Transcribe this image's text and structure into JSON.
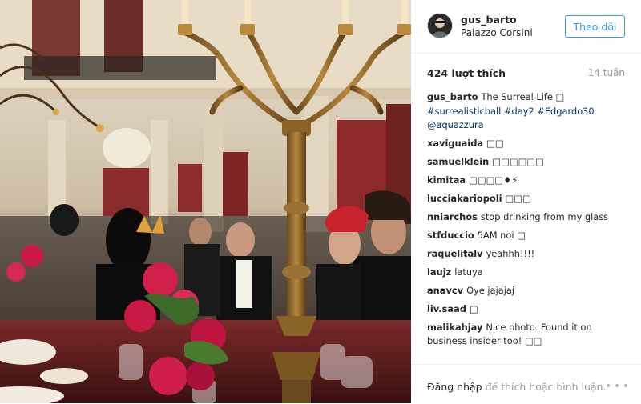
{
  "post": {
    "username": "gus_barto",
    "location": "Palazzo Corsini",
    "follow_label": "Theo dõi",
    "likes": "424 lượt thích",
    "time_ago": "14 tuần"
  },
  "caption": {
    "user": "gus_barto",
    "text": "The Surreal Life □",
    "tags": [
      "#surrealisticball",
      "#day2",
      "#Edgardo30"
    ],
    "mention": "@aquazzura"
  },
  "comments": [
    {
      "user": "xaviguaida",
      "text": "□□"
    },
    {
      "user": "samuelklein",
      "text": "□□□□□□"
    },
    {
      "user": "kimitaa",
      "text": "□□□□♦⚡"
    },
    {
      "user": "lucciakariopoli",
      "text": "□□□"
    },
    {
      "user": "nniarchos",
      "text": "stop drinking from my glass"
    },
    {
      "user": "stfduccio",
      "text": "5AM noi □"
    },
    {
      "user": "raquelitalv",
      "text": "yeahhh!!!!"
    },
    {
      "user": "laujz",
      "text": "latuya"
    },
    {
      "user": "anavcv",
      "text": "Oye jajajaj"
    },
    {
      "user": "liv.saad",
      "text": "□"
    },
    {
      "user": "malikahjay",
      "text": "Nice photo. Found it on business insider too! □□"
    }
  ],
  "footer": {
    "login_link": "Đăng nhập",
    "login_rest": "để thích hoặc bình luận."
  },
  "colors": {
    "accent": "#3897f0",
    "hashtag": "#003569",
    "muted": "#999999",
    "text": "#262626"
  }
}
